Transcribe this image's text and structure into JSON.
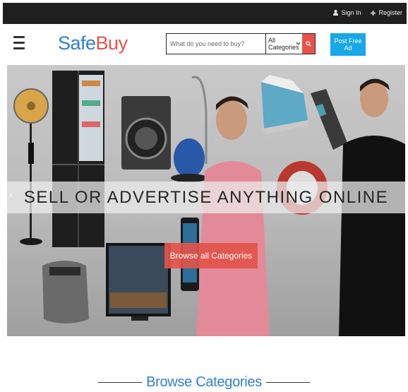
{
  "topbar": {
    "signin_label": "Sign In",
    "register_label": "Register"
  },
  "header": {
    "logo_part1": "Safe",
    "logo_part2": "Buy",
    "search_placeholder": "What do you need to buy?",
    "category_selected": "All Categories",
    "post_ad_label": "Post Free Ad"
  },
  "hero": {
    "headline": "SELL OR ADVERTISE ANYTHING ONLINE",
    "cta_label": "Browse all Categories",
    "prev_glyph": "‹"
  },
  "section": {
    "title": "Browse Categories"
  },
  "colors": {
    "topbar_bg": "#1f1f1f",
    "logo_blue": "#2f7fd0",
    "logo_red": "#e8524a",
    "post_ad_bg": "#18a8e8",
    "search_button_bg": "#e8524a"
  }
}
